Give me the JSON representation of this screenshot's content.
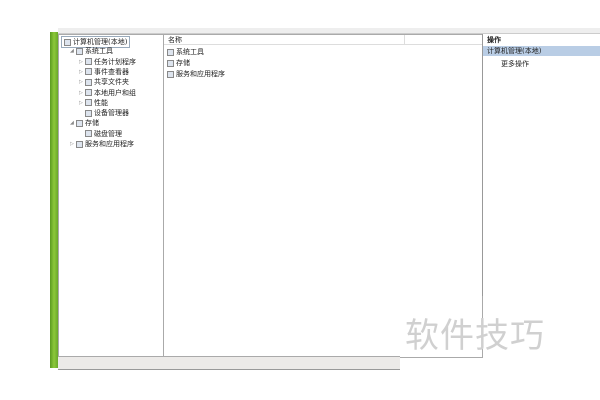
{
  "tree": {
    "items": [
      {
        "label": "计算机管理(本地)",
        "level": 0,
        "tw": "",
        "icon": "computer-icon"
      },
      {
        "label": "系统工具",
        "level": 1,
        "tw": "◢",
        "icon": "tools-icon"
      },
      {
        "label": "任务计划程序",
        "level": 2,
        "tw": "▷",
        "icon": "clock-icon"
      },
      {
        "label": "事件查看器",
        "level": 2,
        "tw": "▷",
        "icon": "event-viewer-icon"
      },
      {
        "label": "共享文件夹",
        "level": 2,
        "tw": "▷",
        "icon": "shared-folder-icon"
      },
      {
        "label": "本地用户和组",
        "level": 2,
        "tw": "▷",
        "icon": "users-icon"
      },
      {
        "label": "性能",
        "level": 2,
        "tw": "▷",
        "icon": "performance-icon"
      },
      {
        "label": "设备管理器",
        "level": 2,
        "tw": "",
        "icon": "device-manager-icon"
      },
      {
        "label": "存储",
        "level": 1,
        "tw": "◢",
        "icon": "storage-icon"
      },
      {
        "label": "磁盘管理",
        "level": 2,
        "tw": "",
        "icon": "disk-icon"
      },
      {
        "label": "服务和应用程序",
        "level": 1,
        "tw": "▷",
        "icon": "services-icon"
      }
    ]
  },
  "center": {
    "header": "名称",
    "items": [
      "系统工具",
      "存储",
      "服务和应用程序"
    ]
  },
  "actions": {
    "header": "操作",
    "selected": "计算机管理(本地)",
    "more": "更多操作"
  },
  "watermark": "软件技巧"
}
